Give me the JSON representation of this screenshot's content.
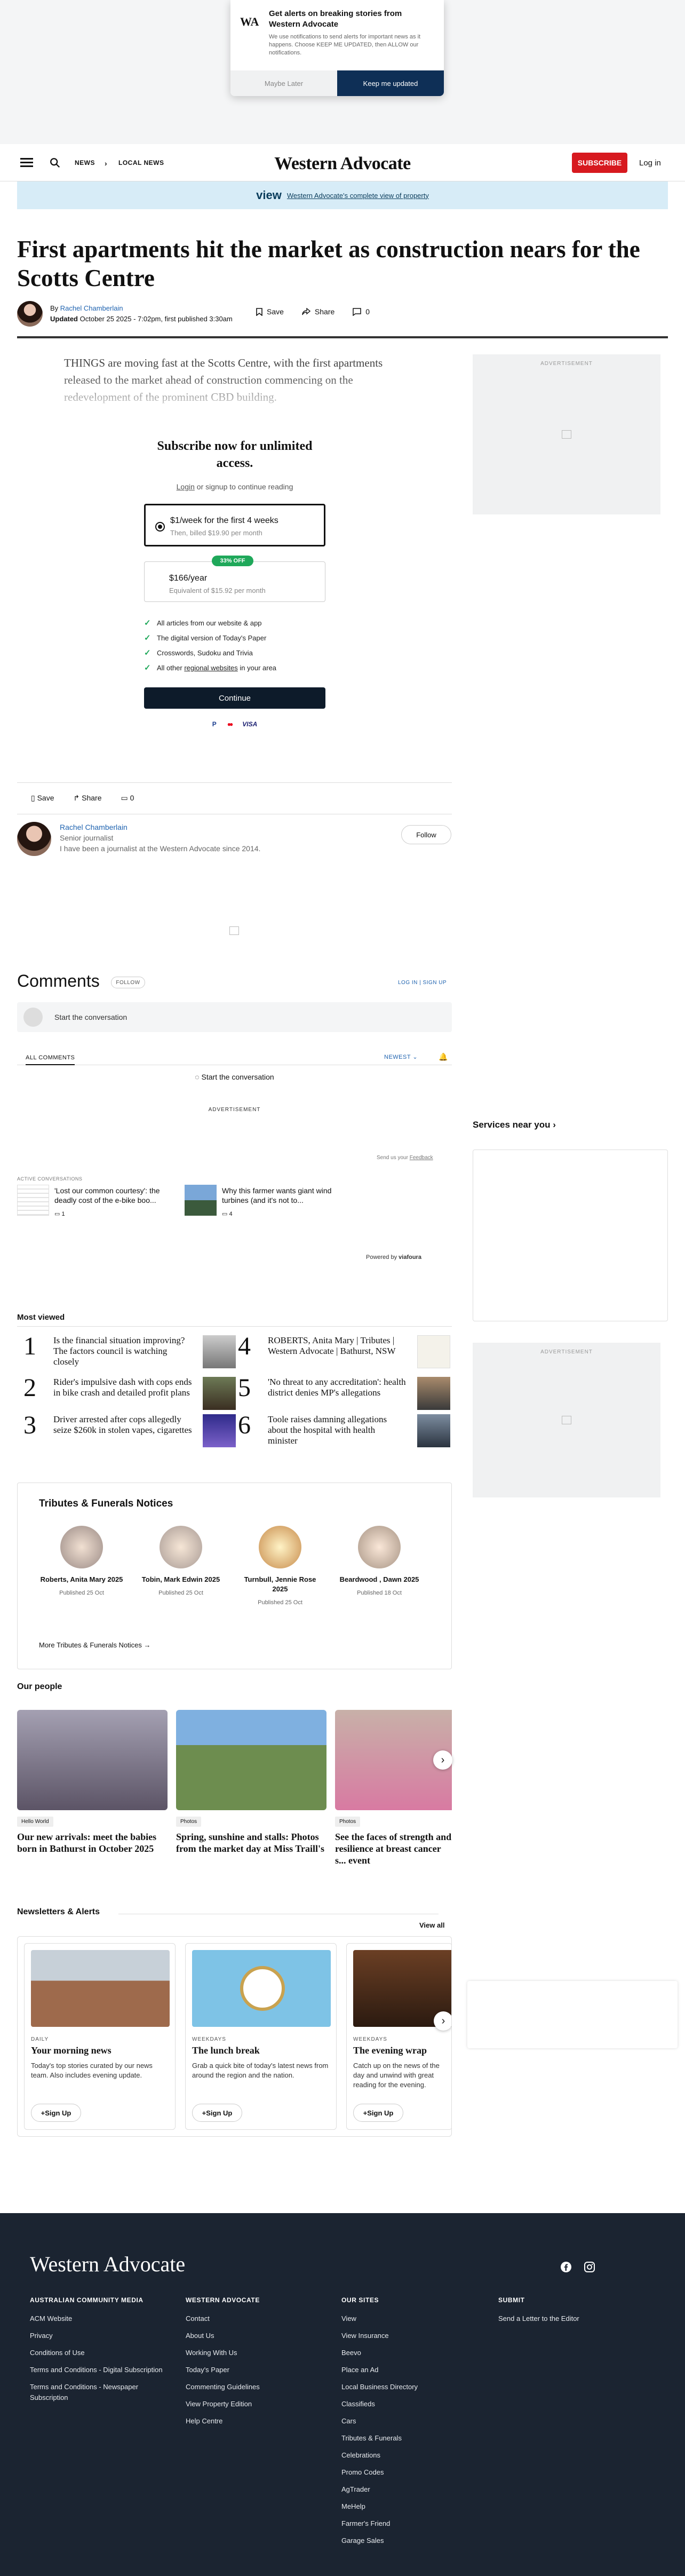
{
  "notification": {
    "badge": "WA",
    "title": "Get alerts on breaking stories from Western Advocate",
    "body": "We use notifications to send alerts for important news as it happens. Choose KEEP ME UPDATED, then ALLOW our notifications.",
    "later": "Maybe Later",
    "keep": "Keep me updated"
  },
  "header": {
    "nav": [
      "NEWS",
      "LOCAL NEWS"
    ],
    "logo": "Western Advocate",
    "subscribe": "SUBSCRIBE",
    "login": "Log in"
  },
  "banner": {
    "brand": "view",
    "text": "Western Advocate's complete view of property"
  },
  "article": {
    "headline": "First apartments hit the market as construction nears for the Scotts Centre",
    "by": "By",
    "author": "Rachel Chamberlain",
    "updated_label": "Updated",
    "updated": "October 25 2025 - 7:02pm, first published 3:30am",
    "save": "Save",
    "share": "Share",
    "comments": "0",
    "lead": "THINGS are moving fast at the Scotts Centre, with the first apartments released to the market ahead of construction commencing on the redevelopment of the prominent CBD building."
  },
  "paywall": {
    "title": "Subscribe now for unlimited access.",
    "login_pre": "Login",
    "login_post": " or signup to continue reading",
    "plan1_title": "$1/week for the first 4 weeks",
    "plan1_sub": "Then, billed $19.90 per month",
    "plan2_badge": "33% OFF",
    "plan2_title": "$166/year",
    "plan2_sub": "Equivalent of $15.92 per month",
    "benefits": [
      "All articles from our website & app",
      "The digital version of Today's Paper",
      "Crosswords, Sudoku and Trivia"
    ],
    "benefit_last_pre": "All other ",
    "benefit_last_link": "regional websites",
    "benefit_last_post": " in your area",
    "continue": "Continue",
    "payment": [
      "P",
      "●●",
      "VISA"
    ]
  },
  "ads": {
    "label": "ADVERTISEMENT"
  },
  "author_box": {
    "name": "Rachel Chamberlain",
    "role": "Senior journalist",
    "bio": "I have been a journalist at the Western Advocate since 2014.",
    "follow": "Follow"
  },
  "comments": {
    "title": "Comments",
    "follow": "FOLLOW",
    "login": "LOG IN | SIGN UP",
    "placeholder": "Start the conversation",
    "tab_all": "ALL COMMENTS",
    "sort": "NEWEST",
    "start2": "Start the conversation",
    "feedback_pre": "Send us your ",
    "feedback_link": "Feedback",
    "active_label": "ACTIVE CONVERSATIONS",
    "active": [
      {
        "title": "'Lost our common courtesy': the deadly cost of the e-bike boo...",
        "count": "1"
      },
      {
        "title": "Why this farmer wants giant wind turbines (and it's not to...",
        "count": "4"
      }
    ],
    "powered": "Powered by",
    "powered_brand": "viafoura"
  },
  "services": {
    "title": "Services near you"
  },
  "most_viewed": {
    "title": "Most viewed",
    "items": [
      {
        "n": "1",
        "title": "Is the financial situation improving? The factors council is watching closely"
      },
      {
        "n": "2",
        "title": "Rider's impulsive dash with cops ends in bike crash and detailed profit plans"
      },
      {
        "n": "3",
        "title": "Driver arrested after cops allegedly seize $260k in stolen vapes, cigarettes"
      },
      {
        "n": "4",
        "title": "ROBERTS, Anita Mary | Tributes | Western Advocate | Bathurst, NSW"
      },
      {
        "n": "5",
        "title": "'No threat to any accreditation': health district denies MP's allegations"
      },
      {
        "n": "6",
        "title": "Toole raises damning allegations about the hospital with health minister"
      }
    ]
  },
  "tributes": {
    "title": "Tributes & Funerals Notices",
    "items": [
      {
        "name": "Roberts, Anita Mary 2025",
        "date": "Published 25 Oct"
      },
      {
        "name": "Tobin, Mark Edwin 2025",
        "date": "Published 25 Oct"
      },
      {
        "name": "Turnbull, Jennie Rose 2025",
        "date": "Published 25 Oct"
      },
      {
        "name": "Beardwood , Dawn 2025",
        "date": "Published 18 Oct"
      }
    ],
    "more": "More Tributes & Funerals Notices"
  },
  "our_people": {
    "title": "Our people",
    "items": [
      {
        "tag": "Hello World",
        "title": "Our new arrivals: meet the babies born in Bathurst in October 2025"
      },
      {
        "tag": "Photos",
        "title": "Spring, sunshine and stalls: Photos from the market day at Miss Traill's"
      },
      {
        "tag": "Photos",
        "title": "See the faces of strength and resilience at breast cancer s... event"
      }
    ]
  },
  "newsletters": {
    "title": "Newsletters & Alerts",
    "view_all": "View all",
    "signup": "Sign Up",
    "items": [
      {
        "freq": "DAILY",
        "title": "Your morning news",
        "desc": "Today's top stories curated by our news team. Also includes evening update."
      },
      {
        "freq": "WEEKDAYS",
        "title": "The lunch break",
        "desc": "Grab a quick bite of today's latest news from around the region and the nation."
      },
      {
        "freq": "WEEKDAYS",
        "title": "The evening wrap",
        "desc": "Catch up on the news of the day and unwind with great reading for the evening."
      }
    ]
  },
  "footer": {
    "logo": "Western Advocate",
    "columns": [
      {
        "title": "AUSTRALIAN COMMUNITY MEDIA",
        "items": [
          "ACM Website",
          "Privacy",
          "Conditions of Use",
          "Terms and Conditions - Digital Subscription",
          "Terms and Conditions - Newspaper Subscription"
        ]
      },
      {
        "title": "WESTERN ADVOCATE",
        "items": [
          "Contact",
          "About Us",
          "Working With Us",
          "Today's Paper",
          "Commenting Guidelines",
          "View Property Edition",
          "Help Centre"
        ]
      },
      {
        "title": "OUR SITES",
        "items": [
          "View",
          "View Insurance",
          "Beevo",
          "Place an Ad",
          "Local Business Directory",
          "Classifieds",
          "Cars",
          "Tributes & Funerals",
          "Celebrations",
          "Promo Codes",
          "AgTrader",
          "MeHelp",
          "Farmer's Friend",
          "Garage Sales"
        ]
      },
      {
        "title": "SUBMIT",
        "items": [
          "Send a Letter to the Editor"
        ]
      }
    ]
  },
  "colors": {
    "accent": "#d7191f",
    "navy": "#0e2f56",
    "footer": "#1b2431",
    "link": "#1f63b0",
    "check": "#1fa85a"
  }
}
